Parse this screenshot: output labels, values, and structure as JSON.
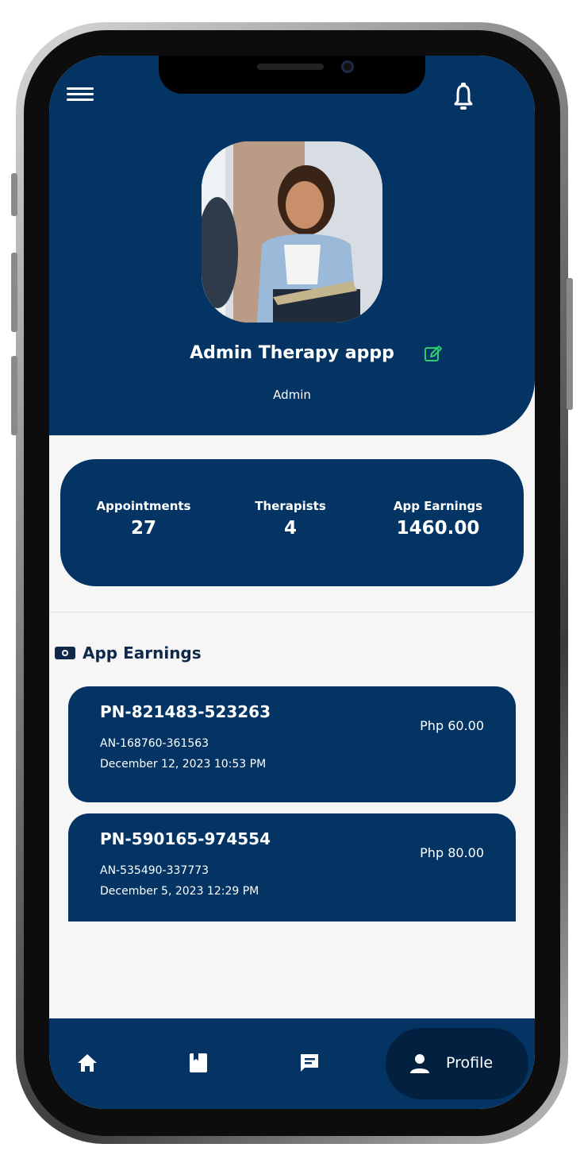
{
  "header": {
    "menu_icon": "menu-icon",
    "notification_icon": "bell-icon"
  },
  "profile": {
    "name": "Admin Therapy appp",
    "role": "Admin",
    "edit_icon": "edit-icon",
    "accent_color": "#2ecc71"
  },
  "stats": [
    {
      "label": "Appointments",
      "value": "27"
    },
    {
      "label": "Therapists",
      "value": "4"
    },
    {
      "label": "App Earnings",
      "value": "1460.00"
    }
  ],
  "earnings": {
    "title": "App Earnings",
    "icon": "cash-icon",
    "items": [
      {
        "pn": "PN-821483-523263",
        "an": "AN-168760-361563",
        "date": "December 12, 2023 10:53 PM",
        "amount": "Php 60.00"
      },
      {
        "pn": "PN-590165-974554",
        "an": "AN-535490-337773",
        "date": "December 5, 2023 12:29 PM",
        "amount": "Php 80.00"
      }
    ]
  },
  "nav": {
    "items": [
      "home-icon",
      "book-icon",
      "chat-icon",
      "person-icon"
    ],
    "active_label": "Profile"
  },
  "colors": {
    "primary": "#033463",
    "nav_active": "#022040",
    "background": "#f6f6f6"
  }
}
